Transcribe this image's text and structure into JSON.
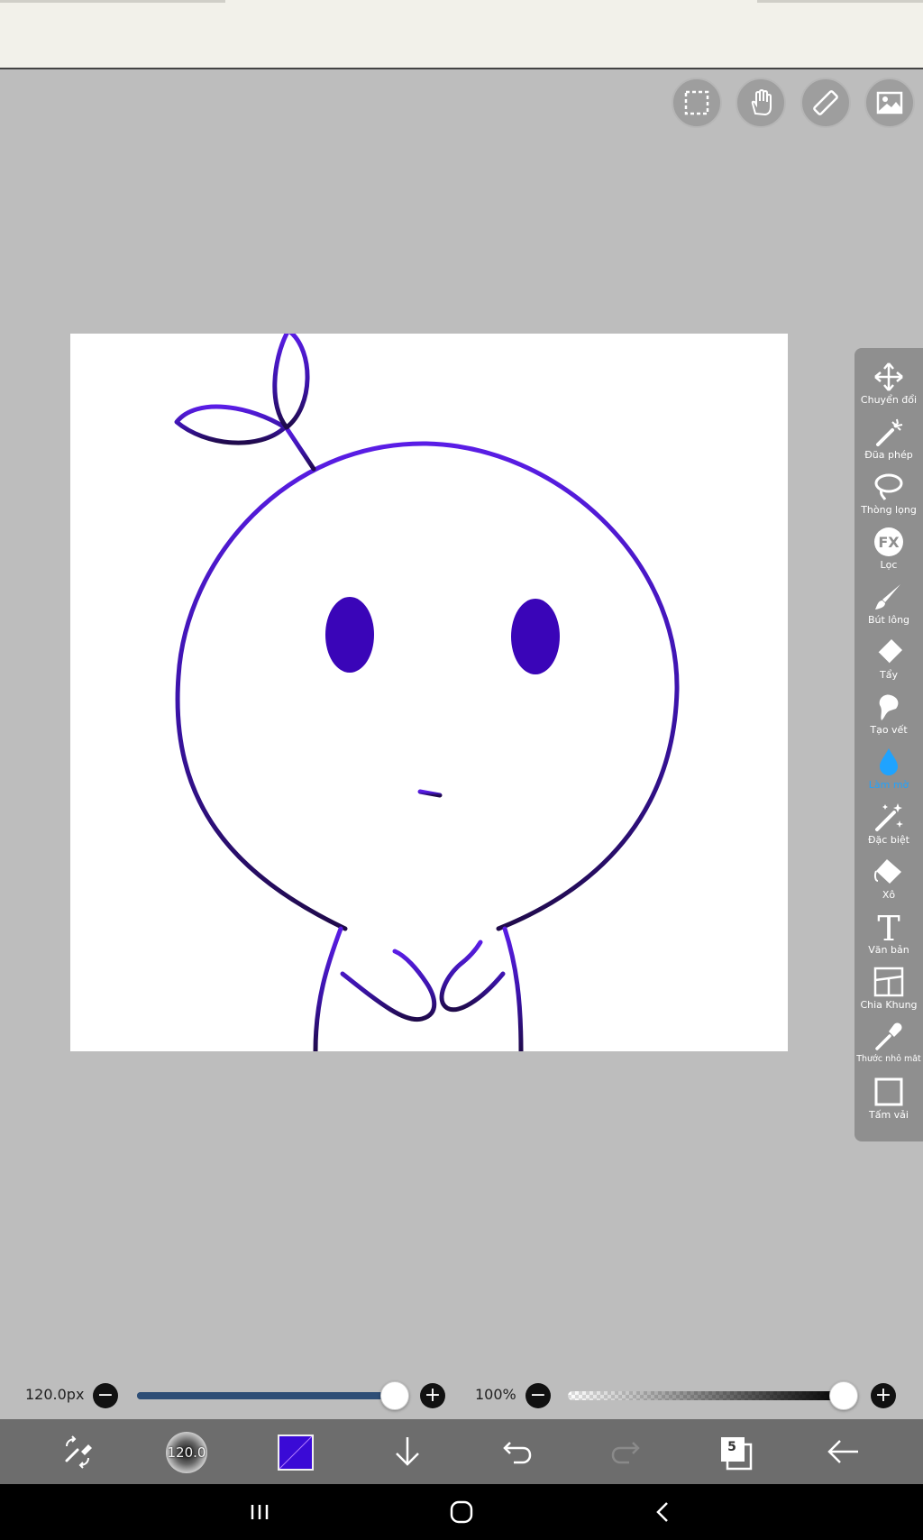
{
  "toolbar_top": {
    "buttons": [
      {
        "name": "selection-icon"
      },
      {
        "name": "hand-icon"
      },
      {
        "name": "ruler-icon"
      },
      {
        "name": "image-icon"
      }
    ]
  },
  "tools": [
    {
      "label": "Chuyển đổi",
      "icon": "move-icon"
    },
    {
      "label": "Đũa phép",
      "icon": "magic-wand-icon"
    },
    {
      "label": "Thòng lọng",
      "icon": "lasso-icon"
    },
    {
      "label": "Lọc",
      "icon": "fx-icon",
      "text": "FX"
    },
    {
      "label": "Bút lông",
      "icon": "brush-icon"
    },
    {
      "label": "Tẩy",
      "icon": "eraser-icon"
    },
    {
      "label": "Tạo vết",
      "icon": "smudge-icon"
    },
    {
      "label": "Làm mờ",
      "icon": "blur-icon",
      "active": true
    },
    {
      "label": "Đặc biệt",
      "icon": "special-icon"
    },
    {
      "label": "Xô",
      "icon": "bucket-icon"
    },
    {
      "label": "Văn bản",
      "icon": "text-icon",
      "text": "T"
    },
    {
      "label": "Chia Khung",
      "icon": "frame-divider-icon"
    },
    {
      "label": "Thước nhỏ mắt",
      "icon": "eyedropper-icon"
    },
    {
      "label": "Tấm vải",
      "icon": "canvas-icon"
    }
  ],
  "brush_size": {
    "label": "120.0px",
    "fraction": 1.0
  },
  "opacity": {
    "label": "100%",
    "fraction": 1.0
  },
  "bottom": {
    "brush_preview_value": "120.0",
    "current_color": "#3a0ad6",
    "layer_count": "5"
  },
  "colors": {
    "accent": "#1fa3ff",
    "stroke_top": "#5a1de6",
    "stroke_bottom": "#1f0a4a",
    "eye": "#3a05b8"
  }
}
